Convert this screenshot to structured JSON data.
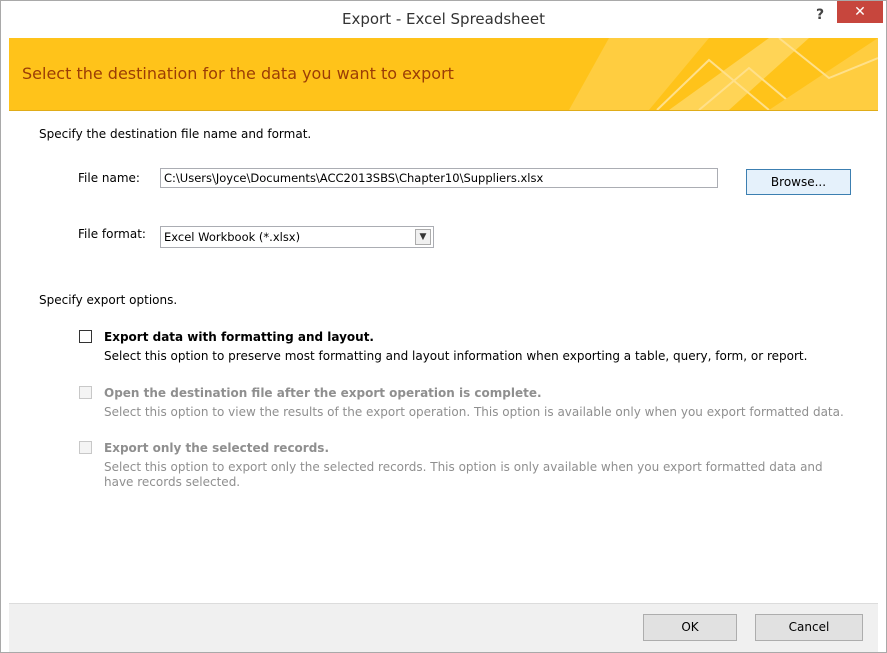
{
  "window": {
    "title": "Export - Excel Spreadsheet",
    "help_label": "?",
    "close_label": "✕"
  },
  "banner": {
    "heading": "Select the destination for the data you want to export",
    "color": "#ffc31a",
    "text_color": "#9b3d06"
  },
  "destination": {
    "section_label": "Specify the destination file name and format.",
    "file_name_label": "File name:",
    "file_name_value": "C:\\Users\\Joyce\\Documents\\ACC2013SBS\\Chapter10\\Suppliers.xlsx",
    "browse_label": "Browse...",
    "file_format_label": "File format:",
    "file_format_value": "Excel Workbook (*.xlsx)",
    "dropdown_icon": "chevron-down-icon"
  },
  "options": {
    "section_label": "Specify export options.",
    "items": [
      {
        "title": "Export data with formatting and layout.",
        "description": "Select this option to preserve most formatting and layout information when exporting a table, query, form, or report.",
        "checked": false,
        "enabled": true
      },
      {
        "title": "Open the destination file after the export operation is complete.",
        "description": "Select this option to view the results of the export operation. This option is available only when you export formatted data.",
        "checked": false,
        "enabled": false
      },
      {
        "title": "Export only the selected records.",
        "description": "Select this option to export only the selected records. This option is only available when you export formatted data and have records selected.",
        "checked": false,
        "enabled": false
      }
    ]
  },
  "footer": {
    "ok_label": "OK",
    "cancel_label": "Cancel"
  }
}
